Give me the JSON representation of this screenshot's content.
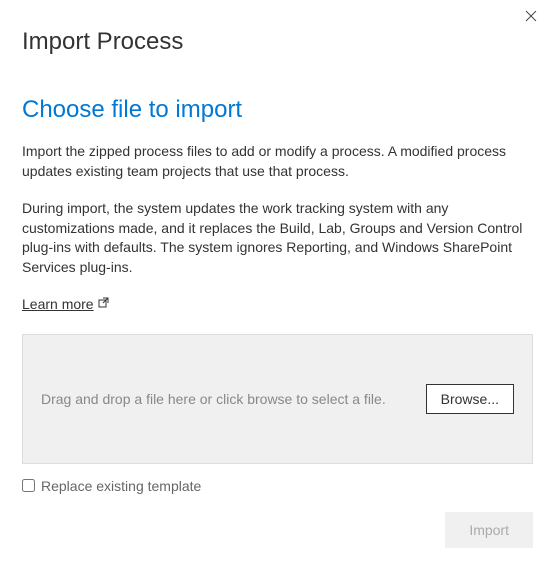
{
  "header": {
    "title": "Import Process"
  },
  "main": {
    "section_title": "Choose file to import",
    "description1": "Import the zipped process files to add or modify a process. A modified process updates existing team projects that use that process.",
    "description2": "During import, the system updates the work tracking system with any customizations made, and it replaces the Build, Lab, Groups and Version Control plug-ins with defaults. The system ignores Reporting, and Windows SharePoint Services plug-ins.",
    "learn_more_label": "Learn more",
    "dropzone_text": "Drag and drop a file here or click browse to select a file.",
    "browse_label": "Browse...",
    "checkbox_label": "Replace existing template"
  },
  "footer": {
    "import_label": "Import"
  }
}
